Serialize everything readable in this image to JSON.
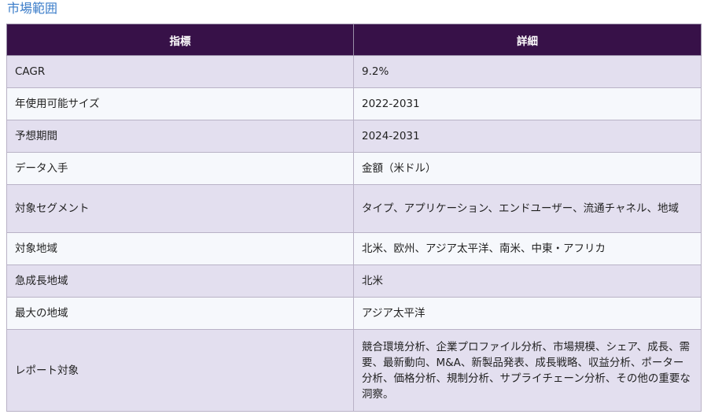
{
  "section": {
    "title": "市場範囲"
  },
  "table": {
    "headers": [
      "指標",
      "詳細"
    ],
    "rows": [
      {
        "metric": "CAGR",
        "detail": "9.2%"
      },
      {
        "metric": "年使用可能サイズ",
        "detail": "2022-2031"
      },
      {
        "metric": "予想期間",
        "detail": "2024-2031"
      },
      {
        "metric": "データ入手",
        "detail": "金額（米ドル）"
      },
      {
        "metric": "対象セグメント",
        "detail": "タイプ、アプリケーション、エンドユーザー、流通チャネル、地域"
      },
      {
        "metric": "対象地域",
        "detail": "北米、欧州、アジア太平洋、南米、中東・アフリカ"
      },
      {
        "metric": "急成長地域",
        "detail": "北米"
      },
      {
        "metric": "最大の地域",
        "detail": "アジア太平洋"
      },
      {
        "metric": "レポート対象",
        "detail": "競合環境分析、企業プロファイル分析、市場規模、シェア、成長、需要、最新動向、M&A、新製品発表、成長戦略、収益分析、ポーター分析、価格分析、規制分析、サプライチェーン分析、その他の重要な洞察。"
      }
    ]
  },
  "colors": {
    "title": "#3a7cc9",
    "header_bg": "#371148",
    "row_odd_bg": "#e3dfef",
    "row_even_bg": "#f6f8fc"
  }
}
